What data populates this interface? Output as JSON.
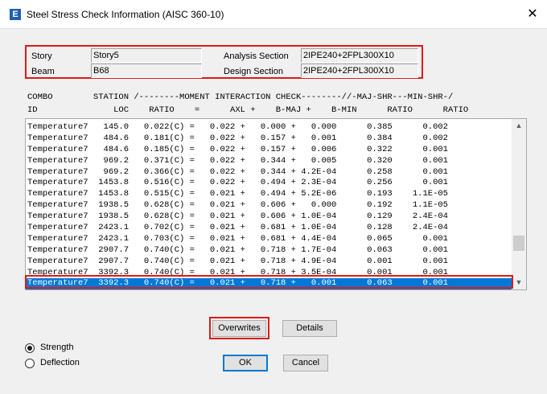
{
  "window": {
    "title": "Steel Stress Check Information (AISC 360-10)",
    "close_glyph": "✕",
    "app_icon_letter": "E"
  },
  "info": {
    "story_label": "Story",
    "story_value": "Story5",
    "beam_label": "Beam",
    "beam_value": "B68",
    "analysis_section_label": "Analysis Section",
    "analysis_section_value": "2IPE240+2FPL300X10",
    "design_section_label": "Design Section",
    "design_section_value": "2IPE240+2FPL300X10"
  },
  "table": {
    "header_line1": "COMBO        STATION /--------MOMENT INTERACTION CHECK--------//-MAJ-SHR---MIN-SHR-/",
    "header_line2": "ID               LOC    RATIO    =      AXL +    B-MAJ +    B-MIN      RATIO      RATIO",
    "rows": [
      "Temperature7   145.0   0.022(C) =   0.022 +   0.000 +   0.000      0.385      0.002",
      "Temperature7   484.6   0.181(C) =   0.022 +   0.157 +   0.001      0.384      0.002",
      "Temperature7   484.6   0.185(C) =   0.022 +   0.157 +   0.006      0.322      0.001",
      "Temperature7   969.2   0.371(C) =   0.022 +   0.344 +   0.005      0.320      0.001",
      "Temperature7   969.2   0.366(C) =   0.022 +   0.344 + 4.2E-04      0.258      0.001",
      "Temperature7  1453.8   0.516(C) =   0.022 +   0.494 + 2.3E-04      0.256      0.001",
      "Temperature7  1453.8   0.515(C) =   0.021 +   0.494 + 5.2E-06      0.193    1.1E-05",
      "Temperature7  1938.5   0.628(C) =   0.021 +   0.606 +   0.000      0.192    1.1E-05",
      "Temperature7  1938.5   0.628(C) =   0.021 +   0.606 + 1.0E-04      0.129    2.4E-04",
      "Temperature7  2423.1   0.702(C) =   0.021 +   0.681 + 1.0E-04      0.128    2.4E-04",
      "Temperature7  2423.1   0.703(C) =   0.021 +   0.681 + 4.4E-04      0.065      0.001",
      "Temperature7  2907.7   0.740(C) =   0.021 +   0.718 + 1.7E-04      0.063      0.001",
      "Temperature7  2907.7   0.740(C) =   0.021 +   0.718 + 4.9E-04      0.001      0.001",
      "Temperature7  3392.3   0.740(C) =   0.021 +   0.718 + 3.5E-04      0.001      0.001",
      "Temperature7  3392.3   0.740(C) =   0.021 +   0.718 +   0.001      0.063      0.001"
    ],
    "scroll_up_glyph": "▲",
    "scroll_down_glyph": "▼"
  },
  "buttons": {
    "overwrites": "Overwrites",
    "details": "Details",
    "ok": "OK",
    "cancel": "Cancel"
  },
  "radios": {
    "strength": "Strength",
    "deflection": "Deflection",
    "selected": "strength"
  },
  "colors": {
    "highlight": "#e21818",
    "selection": "#0078d7"
  }
}
